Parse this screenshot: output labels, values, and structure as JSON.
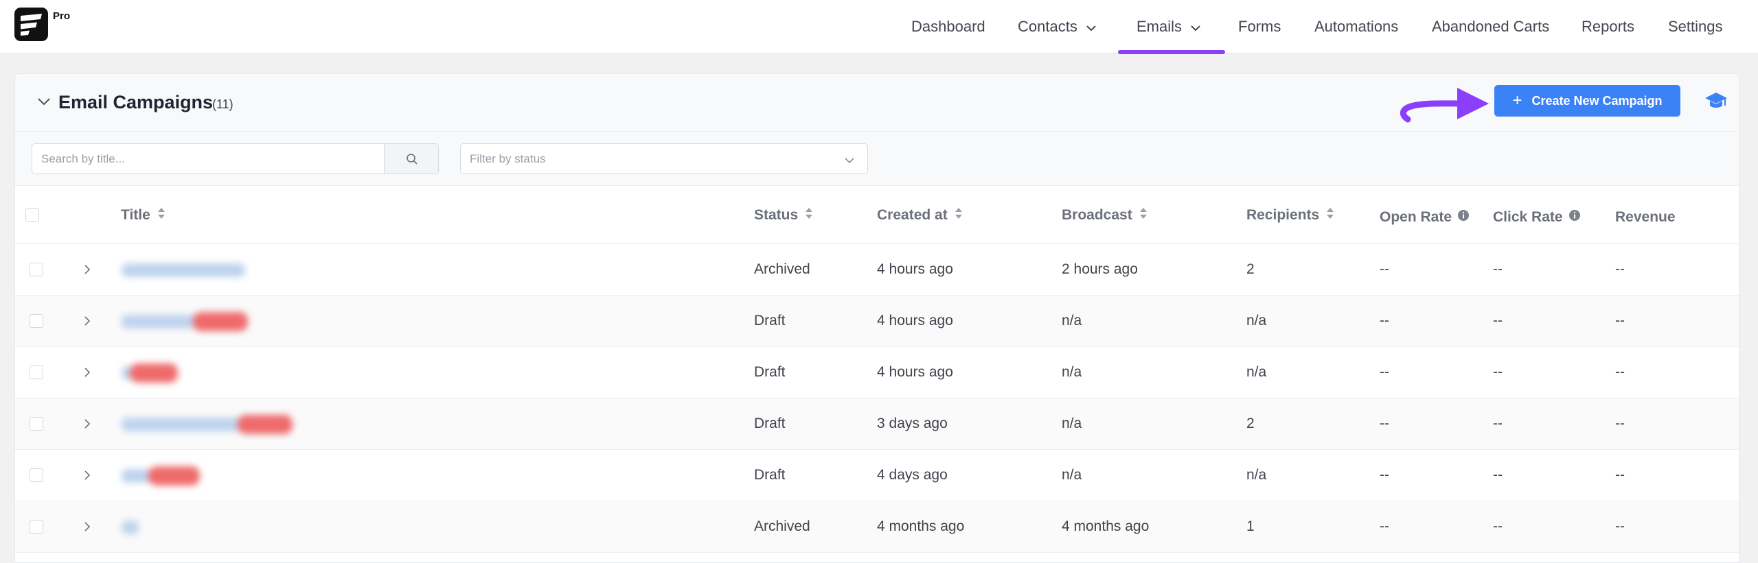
{
  "header": {
    "logo_badge": "Pro",
    "nav": [
      {
        "label": "Dashboard",
        "has_dropdown": false,
        "active": false
      },
      {
        "label": "Contacts",
        "has_dropdown": true,
        "active": false
      },
      {
        "label": "Emails",
        "has_dropdown": true,
        "active": true
      },
      {
        "label": "Forms",
        "has_dropdown": false,
        "active": false
      },
      {
        "label": "Automations",
        "has_dropdown": false,
        "active": false
      },
      {
        "label": "Abandoned Carts",
        "has_dropdown": false,
        "active": false
      },
      {
        "label": "Reports",
        "has_dropdown": false,
        "active": false
      },
      {
        "label": "Settings",
        "has_dropdown": false,
        "active": false
      }
    ],
    "accent_color": "#8b3ffa"
  },
  "campaigns": {
    "title": "Email Campaigns",
    "count": "(11)",
    "create_button": "Create New Campaign",
    "create_button_color": "#3b82f6",
    "search_placeholder": "Search by title...",
    "status_filter_placeholder": "Filter by status",
    "columns": {
      "title": "Title",
      "status": "Status",
      "created_at": "Created at",
      "broadcast": "Broadcast",
      "recipients": "Recipients",
      "open_rate": "Open Rate",
      "click_rate": "Click Rate",
      "revenue": "Revenue"
    },
    "rows": [
      {
        "status": "Archived",
        "created_at": "4 hours ago",
        "broadcast": "2 hours ago",
        "recipients": "2",
        "open_rate": "--",
        "click_rate": "--",
        "revenue": "--"
      },
      {
        "status": "Draft",
        "created_at": "4 hours ago",
        "broadcast": "n/a",
        "recipients": "n/a",
        "open_rate": "--",
        "click_rate": "--",
        "revenue": "--"
      },
      {
        "status": "Draft",
        "created_at": "4 hours ago",
        "broadcast": "n/a",
        "recipients": "n/a",
        "open_rate": "--",
        "click_rate": "--",
        "revenue": "--"
      },
      {
        "status": "Draft",
        "created_at": "3 days ago",
        "broadcast": "n/a",
        "recipients": "2",
        "open_rate": "--",
        "click_rate": "--",
        "revenue": "--"
      },
      {
        "status": "Draft",
        "created_at": "4 days ago",
        "broadcast": "n/a",
        "recipients": "n/a",
        "open_rate": "--",
        "click_rate": "--",
        "revenue": "--"
      },
      {
        "status": "Archived",
        "created_at": "4 months ago",
        "broadcast": "4 months ago",
        "recipients": "1",
        "open_rate": "--",
        "click_rate": "--",
        "revenue": "--"
      }
    ]
  }
}
